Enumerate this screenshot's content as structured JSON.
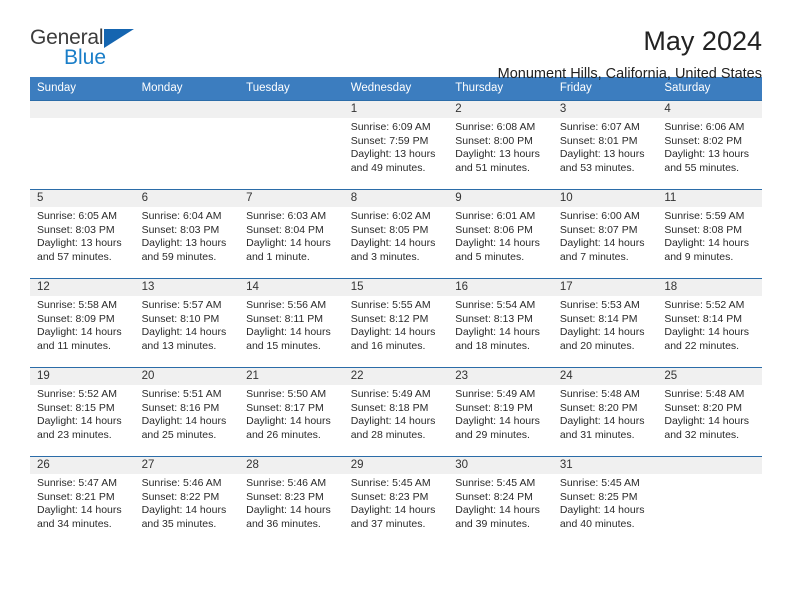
{
  "brand": {
    "name_primary": "General",
    "name_secondary": "Blue",
    "triangle_icon": "triangle-logo-icon",
    "accent_color": "#1565b0"
  },
  "header": {
    "title": "May 2024",
    "subtitle": "Monument Hills, California, United States"
  },
  "calendar": {
    "header_bg": "#3c7dbf",
    "row_border_color": "#2b6ca8",
    "daynum_bg": "#f0f0f0",
    "weekday_headers": [
      "Sunday",
      "Monday",
      "Tuesday",
      "Wednesday",
      "Thursday",
      "Friday",
      "Saturday"
    ],
    "weeks": [
      [
        {
          "day": "",
          "sunrise": "",
          "sunset": "",
          "daylight_line1": "",
          "daylight_line2": "",
          "empty": true
        },
        {
          "day": "",
          "sunrise": "",
          "sunset": "",
          "daylight_line1": "",
          "daylight_line2": "",
          "empty": true
        },
        {
          "day": "",
          "sunrise": "",
          "sunset": "",
          "daylight_line1": "",
          "daylight_line2": "",
          "empty": true
        },
        {
          "day": "1",
          "sunrise": "Sunrise: 6:09 AM",
          "sunset": "Sunset: 7:59 PM",
          "daylight_line1": "Daylight: 13 hours",
          "daylight_line2": "and 49 minutes."
        },
        {
          "day": "2",
          "sunrise": "Sunrise: 6:08 AM",
          "sunset": "Sunset: 8:00 PM",
          "daylight_line1": "Daylight: 13 hours",
          "daylight_line2": "and 51 minutes."
        },
        {
          "day": "3",
          "sunrise": "Sunrise: 6:07 AM",
          "sunset": "Sunset: 8:01 PM",
          "daylight_line1": "Daylight: 13 hours",
          "daylight_line2": "and 53 minutes."
        },
        {
          "day": "4",
          "sunrise": "Sunrise: 6:06 AM",
          "sunset": "Sunset: 8:02 PM",
          "daylight_line1": "Daylight: 13 hours",
          "daylight_line2": "and 55 minutes."
        }
      ],
      [
        {
          "day": "5",
          "sunrise": "Sunrise: 6:05 AM",
          "sunset": "Sunset: 8:03 PM",
          "daylight_line1": "Daylight: 13 hours",
          "daylight_line2": "and 57 minutes."
        },
        {
          "day": "6",
          "sunrise": "Sunrise: 6:04 AM",
          "sunset": "Sunset: 8:03 PM",
          "daylight_line1": "Daylight: 13 hours",
          "daylight_line2": "and 59 minutes."
        },
        {
          "day": "7",
          "sunrise": "Sunrise: 6:03 AM",
          "sunset": "Sunset: 8:04 PM",
          "daylight_line1": "Daylight: 14 hours",
          "daylight_line2": "and 1 minute."
        },
        {
          "day": "8",
          "sunrise": "Sunrise: 6:02 AM",
          "sunset": "Sunset: 8:05 PM",
          "daylight_line1": "Daylight: 14 hours",
          "daylight_line2": "and 3 minutes."
        },
        {
          "day": "9",
          "sunrise": "Sunrise: 6:01 AM",
          "sunset": "Sunset: 8:06 PM",
          "daylight_line1": "Daylight: 14 hours",
          "daylight_line2": "and 5 minutes."
        },
        {
          "day": "10",
          "sunrise": "Sunrise: 6:00 AM",
          "sunset": "Sunset: 8:07 PM",
          "daylight_line1": "Daylight: 14 hours",
          "daylight_line2": "and 7 minutes."
        },
        {
          "day": "11",
          "sunrise": "Sunrise: 5:59 AM",
          "sunset": "Sunset: 8:08 PM",
          "daylight_line1": "Daylight: 14 hours",
          "daylight_line2": "and 9 minutes."
        }
      ],
      [
        {
          "day": "12",
          "sunrise": "Sunrise: 5:58 AM",
          "sunset": "Sunset: 8:09 PM",
          "daylight_line1": "Daylight: 14 hours",
          "daylight_line2": "and 11 minutes."
        },
        {
          "day": "13",
          "sunrise": "Sunrise: 5:57 AM",
          "sunset": "Sunset: 8:10 PM",
          "daylight_line1": "Daylight: 14 hours",
          "daylight_line2": "and 13 minutes."
        },
        {
          "day": "14",
          "sunrise": "Sunrise: 5:56 AM",
          "sunset": "Sunset: 8:11 PM",
          "daylight_line1": "Daylight: 14 hours",
          "daylight_line2": "and 15 minutes."
        },
        {
          "day": "15",
          "sunrise": "Sunrise: 5:55 AM",
          "sunset": "Sunset: 8:12 PM",
          "daylight_line1": "Daylight: 14 hours",
          "daylight_line2": "and 16 minutes."
        },
        {
          "day": "16",
          "sunrise": "Sunrise: 5:54 AM",
          "sunset": "Sunset: 8:13 PM",
          "daylight_line1": "Daylight: 14 hours",
          "daylight_line2": "and 18 minutes."
        },
        {
          "day": "17",
          "sunrise": "Sunrise: 5:53 AM",
          "sunset": "Sunset: 8:14 PM",
          "daylight_line1": "Daylight: 14 hours",
          "daylight_line2": "and 20 minutes."
        },
        {
          "day": "18",
          "sunrise": "Sunrise: 5:52 AM",
          "sunset": "Sunset: 8:14 PM",
          "daylight_line1": "Daylight: 14 hours",
          "daylight_line2": "and 22 minutes."
        }
      ],
      [
        {
          "day": "19",
          "sunrise": "Sunrise: 5:52 AM",
          "sunset": "Sunset: 8:15 PM",
          "daylight_line1": "Daylight: 14 hours",
          "daylight_line2": "and 23 minutes."
        },
        {
          "day": "20",
          "sunrise": "Sunrise: 5:51 AM",
          "sunset": "Sunset: 8:16 PM",
          "daylight_line1": "Daylight: 14 hours",
          "daylight_line2": "and 25 minutes."
        },
        {
          "day": "21",
          "sunrise": "Sunrise: 5:50 AM",
          "sunset": "Sunset: 8:17 PM",
          "daylight_line1": "Daylight: 14 hours",
          "daylight_line2": "and 26 minutes."
        },
        {
          "day": "22",
          "sunrise": "Sunrise: 5:49 AM",
          "sunset": "Sunset: 8:18 PM",
          "daylight_line1": "Daylight: 14 hours",
          "daylight_line2": "and 28 minutes."
        },
        {
          "day": "23",
          "sunrise": "Sunrise: 5:49 AM",
          "sunset": "Sunset: 8:19 PM",
          "daylight_line1": "Daylight: 14 hours",
          "daylight_line2": "and 29 minutes."
        },
        {
          "day": "24",
          "sunrise": "Sunrise: 5:48 AM",
          "sunset": "Sunset: 8:20 PM",
          "daylight_line1": "Daylight: 14 hours",
          "daylight_line2": "and 31 minutes."
        },
        {
          "day": "25",
          "sunrise": "Sunrise: 5:48 AM",
          "sunset": "Sunset: 8:20 PM",
          "daylight_line1": "Daylight: 14 hours",
          "daylight_line2": "and 32 minutes."
        }
      ],
      [
        {
          "day": "26",
          "sunrise": "Sunrise: 5:47 AM",
          "sunset": "Sunset: 8:21 PM",
          "daylight_line1": "Daylight: 14 hours",
          "daylight_line2": "and 34 minutes."
        },
        {
          "day": "27",
          "sunrise": "Sunrise: 5:46 AM",
          "sunset": "Sunset: 8:22 PM",
          "daylight_line1": "Daylight: 14 hours",
          "daylight_line2": "and 35 minutes."
        },
        {
          "day": "28",
          "sunrise": "Sunrise: 5:46 AM",
          "sunset": "Sunset: 8:23 PM",
          "daylight_line1": "Daylight: 14 hours",
          "daylight_line2": "and 36 minutes."
        },
        {
          "day": "29",
          "sunrise": "Sunrise: 5:45 AM",
          "sunset": "Sunset: 8:23 PM",
          "daylight_line1": "Daylight: 14 hours",
          "daylight_line2": "and 37 minutes."
        },
        {
          "day": "30",
          "sunrise": "Sunrise: 5:45 AM",
          "sunset": "Sunset: 8:24 PM",
          "daylight_line1": "Daylight: 14 hours",
          "daylight_line2": "and 39 minutes."
        },
        {
          "day": "31",
          "sunrise": "Sunrise: 5:45 AM",
          "sunset": "Sunset: 8:25 PM",
          "daylight_line1": "Daylight: 14 hours",
          "daylight_line2": "and 40 minutes."
        },
        {
          "day": "",
          "sunrise": "",
          "sunset": "",
          "daylight_line1": "",
          "daylight_line2": "",
          "empty": true
        }
      ]
    ]
  }
}
